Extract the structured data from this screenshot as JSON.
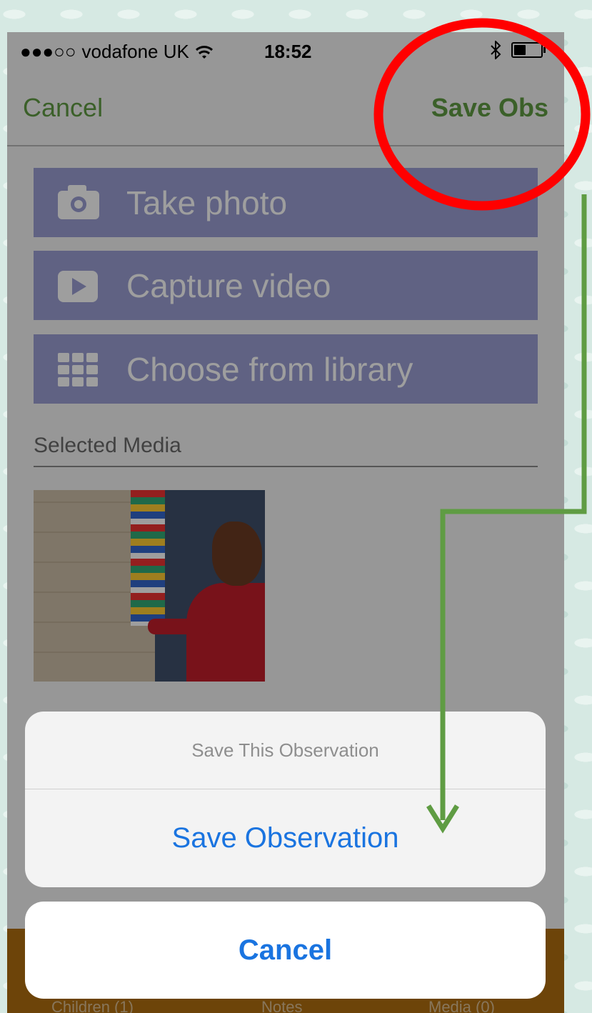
{
  "status_bar": {
    "signal": "●●●○○",
    "carrier": "vodafone UK",
    "wifi_icon": "wifi-icon",
    "time": "18:52",
    "bluetooth_icon": "bluetooth-icon",
    "battery_level": 0.45
  },
  "nav": {
    "cancel_label": "Cancel",
    "save_label": "Save Obs"
  },
  "media_buttons": {
    "take_photo": "Take photo",
    "capture_video": "Capture video",
    "choose_library": "Choose from library"
  },
  "selected_media_label": "Selected Media",
  "action_sheet": {
    "title": "Save This Observation",
    "action_label": "Save Observation",
    "cancel_label": "Cancel"
  },
  "tabs": [
    "Children (1)",
    "Notes",
    "Media (0)"
  ],
  "colors": {
    "accent_green": "#5f9c43",
    "ios_blue": "#1a74e0",
    "highlight_red": "#ff0000",
    "tab_bar_brown": "#b16f10",
    "media_button": "#9b9fd3"
  }
}
